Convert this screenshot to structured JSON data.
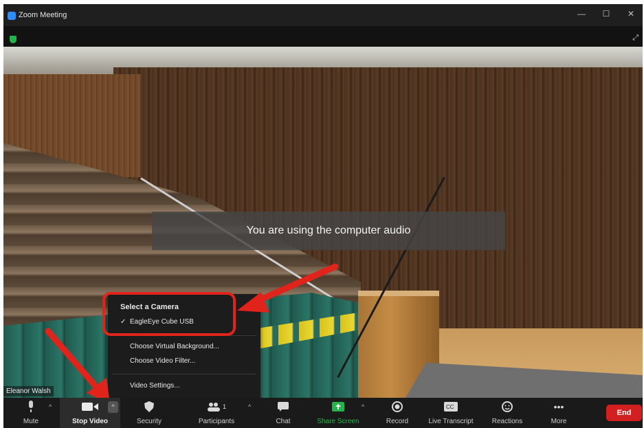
{
  "window": {
    "title": "Zoom Meeting"
  },
  "video": {
    "notice": "You are using the computer audio",
    "participant_name": "Eleanor Walsh"
  },
  "camera_menu": {
    "heading": "Select a Camera",
    "selected_camera": "EagleEye Cube USB",
    "items": [
      "Choose Virtual Background...",
      "Choose Video Filter..."
    ],
    "settings": "Video Settings..."
  },
  "toolbar": {
    "mute": "Mute",
    "stop_video": "Stop Video",
    "security": "Security",
    "participants": "Participants",
    "participants_count": "1",
    "chat": "Chat",
    "share_screen": "Share Screen",
    "record": "Record",
    "live_transcript": "Live Transcript",
    "reactions": "Reactions",
    "more": "More",
    "end": "End"
  },
  "colors": {
    "accent_green": "#24b24a",
    "end_red": "#d21f1f",
    "annotation_red": "#e0241b"
  }
}
